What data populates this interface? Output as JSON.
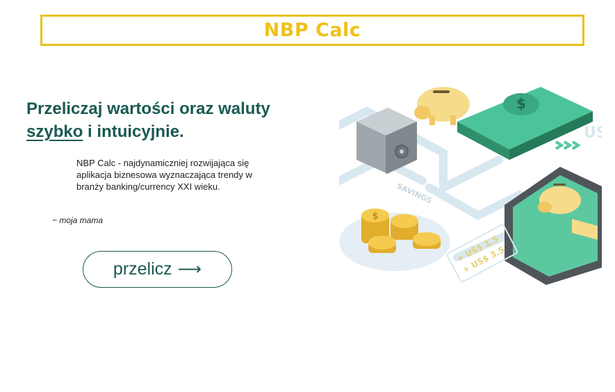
{
  "header": {
    "title": "NBP Calc"
  },
  "hero": {
    "headline_before": "Przeliczaj wartości oraz waluty",
    "headline_underlined": "szybko",
    "headline_after": " i intuicyjnie.",
    "quote": "NBP Calc - najdynamiczniej rozwijająca się aplikacja biznesowa wyznaczająca trendy w branży banking/currency XXI wieku.",
    "author": "~ moja mama",
    "button_label": "przelicz",
    "button_icon": "arrow-right-icon"
  },
  "illustration": {
    "savings_label": "SAVINGS",
    "tag_line1": "+ US$ 1.5",
    "tag_line2": "+ US$ 3.5",
    "bill_symbol": "$",
    "coin_symbol": "$",
    "corner_text": "US"
  },
  "colors": {
    "brand_yellow": "#eec21b",
    "primary_teal": "#1a5a52",
    "money_green": "#3cb88a"
  }
}
